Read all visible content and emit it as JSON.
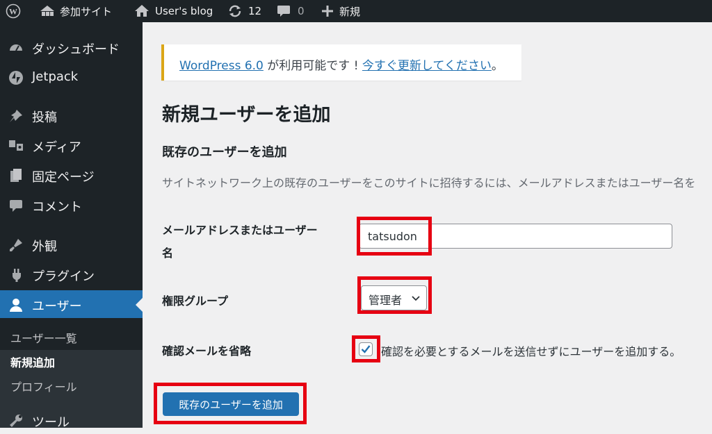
{
  "adminbar": {
    "site_name": "参加サイト",
    "blog_name": "User's blog",
    "updates_count": "12",
    "comments_count": "0",
    "new_label": "新規"
  },
  "sidebar": {
    "items": [
      {
        "label": "ダッシュボード",
        "icon": "dashboard-icon"
      },
      {
        "label": "Jetpack",
        "icon": "jetpack-icon"
      },
      {
        "label": "投稿",
        "icon": "pin-icon"
      },
      {
        "label": "メディア",
        "icon": "media-icon"
      },
      {
        "label": "固定ページ",
        "icon": "pages-icon"
      },
      {
        "label": "コメント",
        "icon": "comment-icon"
      },
      {
        "label": "外観",
        "icon": "appearance-icon"
      },
      {
        "label": "プラグイン",
        "icon": "plugin-icon"
      },
      {
        "label": "ユーザー",
        "icon": "user-icon"
      },
      {
        "label": "ツール",
        "icon": "tools-icon"
      }
    ],
    "submenu": [
      {
        "label": "ユーザー一覧"
      },
      {
        "label": "新規追加"
      },
      {
        "label": "プロフィール"
      }
    ]
  },
  "notice": {
    "link_version": "WordPress 6.0",
    "text_mid": " が利用可能です ! ",
    "link_update": "今すぐ更新してください",
    "text_end": "。"
  },
  "page": {
    "title": "新規ユーザーを追加",
    "section_title": "既存のユーザーを追加",
    "description": "サイトネットワーク上の既存のユーザーをこのサイトに招待するには、メールアドレスまたはユーザー名を"
  },
  "form": {
    "email_label_line1": "メールアドレスまたはユーザー",
    "email_label_line2": "名",
    "email_value": "tatsudon",
    "role_label": "権限グループ",
    "role_value": "管理者",
    "skip_label": "確認メールを省略",
    "skip_checked": true,
    "skip_description": "確認を必要とするメールを送信せずにユーザーを追加する。",
    "submit_label": "既存のユーザーを追加"
  },
  "colors": {
    "admin_dark": "#1d2327",
    "accent_blue": "#2271b1",
    "highlight_red": "#e60012",
    "notice_yellow": "#dba617"
  }
}
